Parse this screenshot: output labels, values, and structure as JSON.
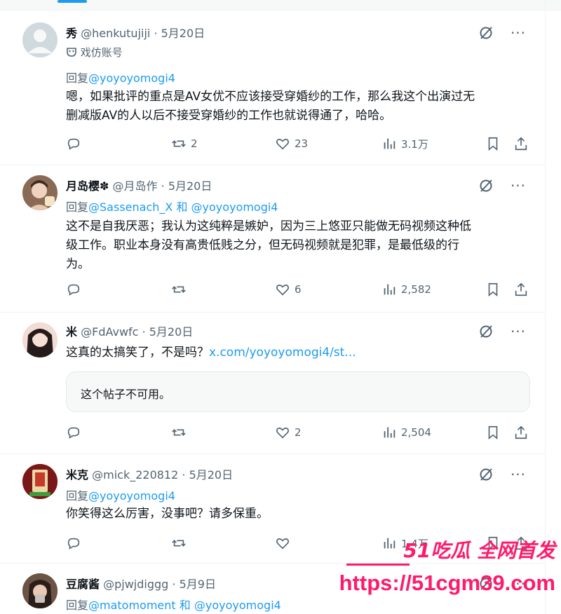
{
  "tweets": [
    {
      "name": "秀",
      "handle": "@henkutujiji",
      "date": "5月20日",
      "parody_label": "戏仿账号",
      "reply_prefix": "回复",
      "reply_to_1": "@yoyoyomogi4",
      "body_line_1": "嗯，如果批评的重点是AV女优不应该接受穿婚纱的工作，那么我这个出演过无",
      "body_line_2": "删减版AV的人以后不接受穿婚纱的工作也就说得通了，哈哈。",
      "retweets": "2",
      "likes": "23",
      "views": "3.1万"
    },
    {
      "name": "月岛樱✽",
      "handle": "@月岛作",
      "date": "5月20日",
      "reply_prefix": "回复",
      "reply_to_1": "@Sassenach_X",
      "reply_and": "和",
      "reply_to_2": "@yoyoyomogi4",
      "body_line_1": "这不是自我厌恶；我认为这纯粹是嫉妒，因为三上悠亚只能做无码视频这种低",
      "body_line_2": "级工作。职业本身没有高贵低贱之分，但无码视频就是犯罪，是最低级的行",
      "body_line_3": "为。",
      "likes": "6",
      "views": "2,582"
    },
    {
      "name": "米",
      "handle": "@FdAvwfc",
      "date": "5月20日",
      "body_text": "这真的太搞笑了，不是吗？",
      "body_link": "x.com/yoyoyomogi4/st...",
      "unavailable": "这个帖子不可用。",
      "likes": "2",
      "views": "2,504"
    },
    {
      "name": "米克",
      "handle": "@mick_220812",
      "date": "5月20日",
      "reply_prefix": "回复",
      "reply_to_1": "@yoyoyomogi4",
      "body_line_1": "你笑得这么厉害，没事吧？请多保重。",
      "views": "1.4万"
    },
    {
      "name": "豆腐酱",
      "handle": "@pjwjdiggg",
      "date": "5月9日",
      "reply_prefix": "回复",
      "reply_to_1": "@matomoment",
      "reply_and": "和",
      "reply_to_2": "@yoyoyomogi4"
    }
  ],
  "watermark": {
    "top": "51吃瓜 全网首发",
    "url": "https://51cgm39.com"
  },
  "colors": {
    "accent": "#1d9bf0",
    "muted": "#536471",
    "watermark": "#ff1a6c"
  }
}
